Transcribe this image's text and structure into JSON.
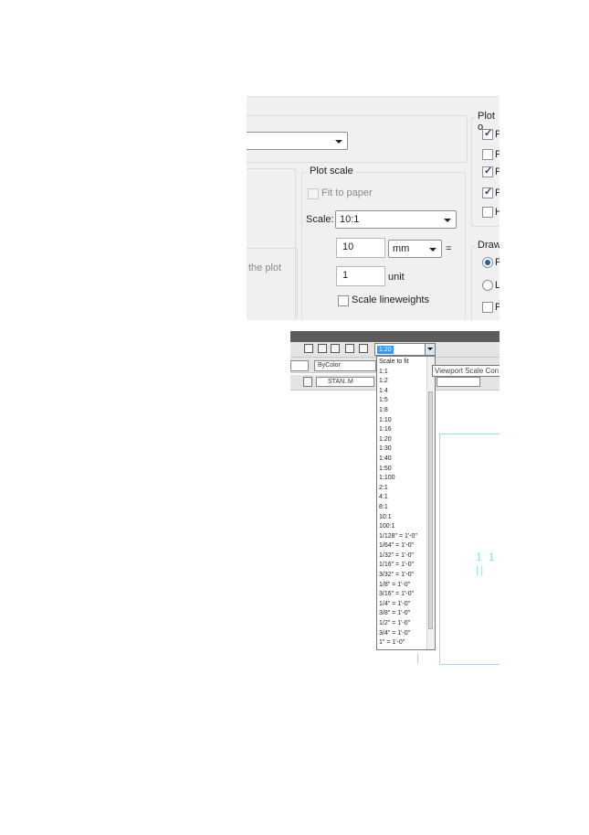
{
  "dialog": {
    "plot_scale_title": "Plot scale",
    "fit_to_paper_label": "Fit to paper",
    "scale_label": "Scale:",
    "scale_value": "10:1",
    "units_value": "10",
    "units_type": "mm",
    "equals": "=",
    "drawing_units_value": "1",
    "unit_label": "unit",
    "scale_lineweights_label": "Scale lineweights",
    "partial_text": "the plot",
    "plot_options_partial": "Plot o",
    "drawing_orientation_partial": "Draw",
    "right_labels": [
      "P",
      "P",
      "P",
      "P",
      "H"
    ],
    "orientation_labels": [
      "P",
      "L",
      "P"
    ],
    "checks": {
      "fit_to_paper": false,
      "scale_lineweights": false,
      "right": [
        true,
        false,
        true,
        true,
        false
      ]
    }
  },
  "cad": {
    "scale_combo_value": "1:20",
    "tooltip": "Viewport Scale Con",
    "bycolor": "ByColor",
    "style_text": "STAN..M",
    "scale_list": [
      "Scale to fit",
      "1:1",
      "1:2",
      "1:4",
      "1:5",
      "1:8",
      "1:10",
      "1:16",
      "1:20",
      "1:30",
      "1:40",
      "1:50",
      "1:100",
      "2:1",
      "4:1",
      "8:1",
      "10:1",
      "100:1",
      "1/128\" = 1'-0\"",
      "1/64\" = 1'-0\"",
      "1/32\" = 1'-0\"",
      "1/16\" = 1'-0\"",
      "3/32\" = 1'-0\"",
      "1/8\" = 1'-0\"",
      "3/16\" = 1'-0\"",
      "1/4\" = 1'-0\"",
      "3/8\" = 1'-0\"",
      "1/2\" = 1'-0\"",
      "3/4\" = 1'-0\"",
      "1\" = 1'-0\""
    ],
    "canvas_text": "1 1 ||"
  },
  "colors": {
    "accent": "#3399ff",
    "canvas_line": "#8fe3e8"
  }
}
